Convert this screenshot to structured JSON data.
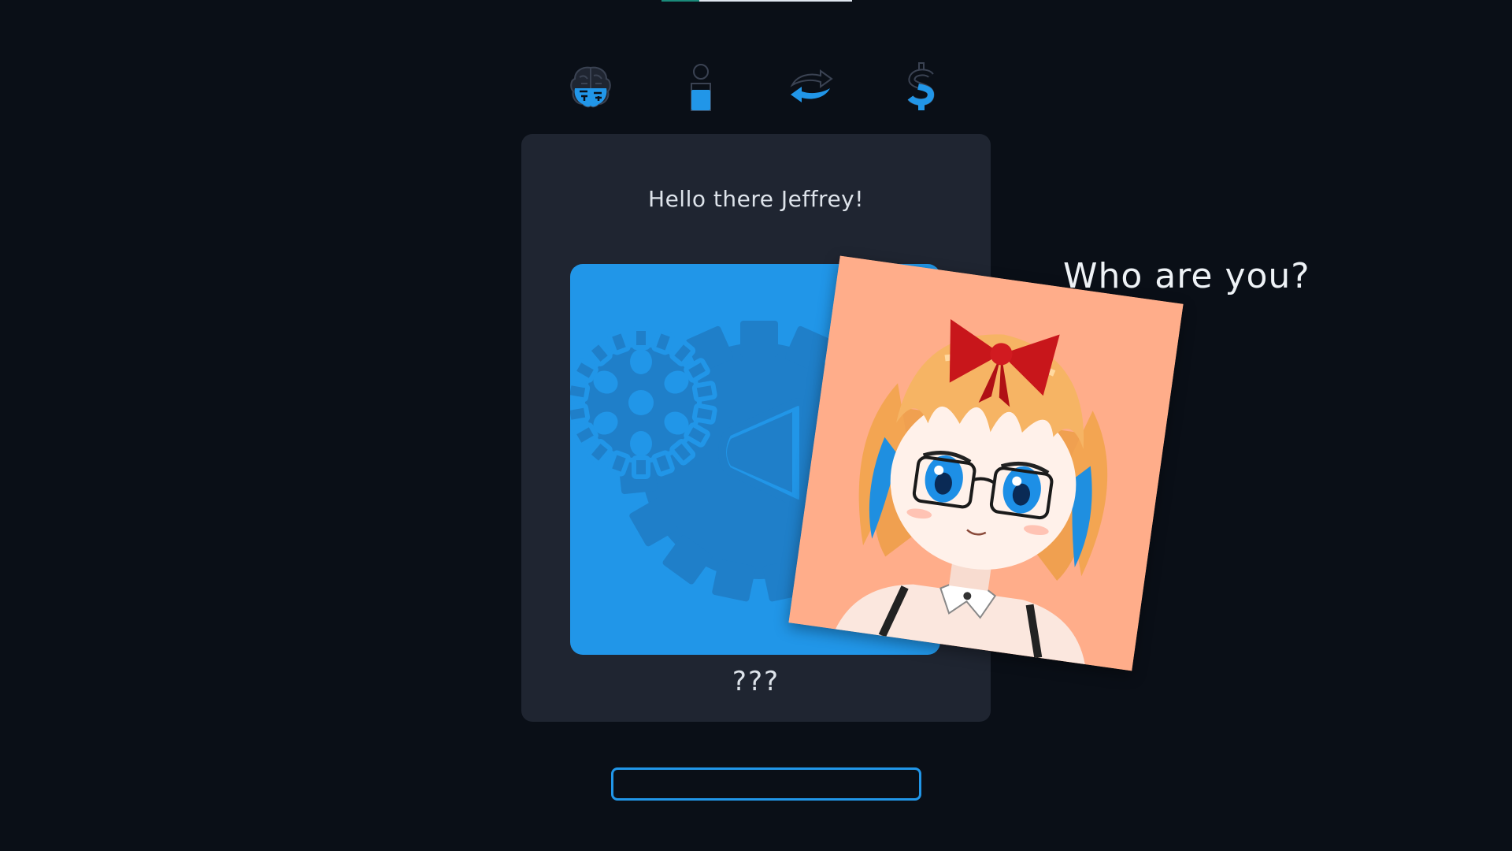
{
  "progress": {
    "fraction": 0.2
  },
  "steps": [
    {
      "icon": "brain-icon"
    },
    {
      "icon": "person-icon"
    },
    {
      "icon": "swap-arrows-icon"
    },
    {
      "icon": "dollar-icon"
    }
  ],
  "card": {
    "greeting": "Hello there Jeffrey!",
    "name_label": "???",
    "placeholder_icon": "gear-play-icon"
  },
  "prompt": {
    "text": "Who are you?"
  },
  "name_input": {
    "value": "",
    "placeholder": ""
  },
  "colors": {
    "background": "#0a0f17",
    "card": "#1f2531",
    "accent": "#2196e8",
    "progress_fill": "#1a8a7a",
    "avatar_background": "#ffad8a"
  }
}
